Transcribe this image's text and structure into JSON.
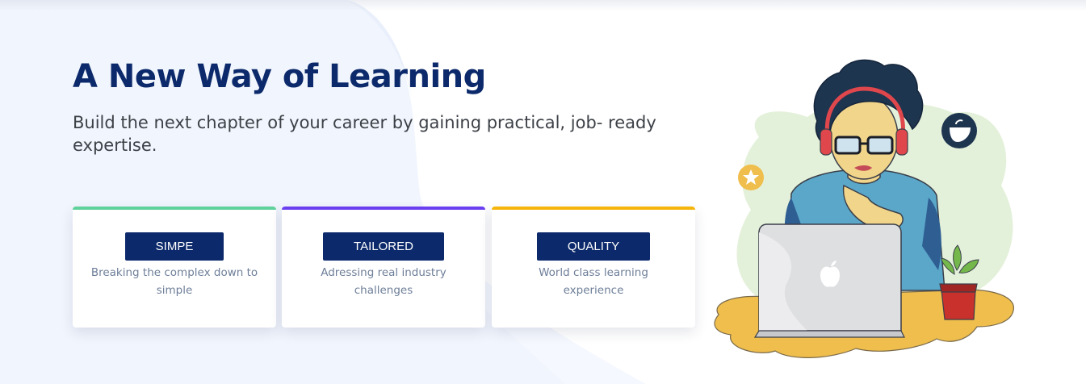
{
  "hero": {
    "title": "A New Way of Learning",
    "subtitle": "Build the next chapter of your career by gaining practical, job- ready expertise."
  },
  "features": [
    {
      "badge": "SIMPE",
      "description": "Breaking the complex down to simple",
      "accent_color": "#5fd19b"
    },
    {
      "badge": "TAILORED",
      "description": "Adressing real industry challenges",
      "accent_color": "#6a3ff0"
    },
    {
      "badge": "QUALITY",
      "description": "World class learning experience",
      "accent_color": "#f5b50a"
    }
  ],
  "colors": {
    "primary": "#0c2a6b",
    "background_tint": "#f1f5fd",
    "muted_text": "#6e7f99"
  },
  "illustration": {
    "icons": [
      "woman-with-laptop-illustration",
      "star-icon",
      "chat-bubble-icon",
      "apple-logo-icon",
      "plant-icon"
    ]
  }
}
